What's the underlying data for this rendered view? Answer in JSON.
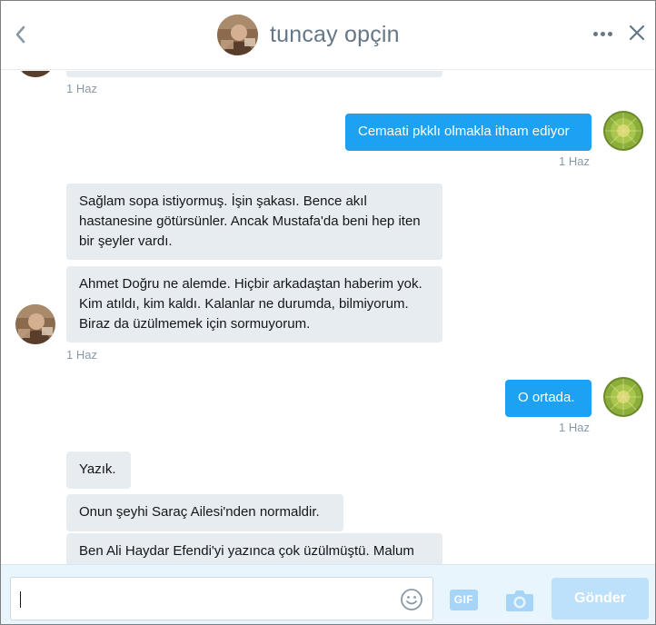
{
  "header": {
    "title": "tuncay opçin",
    "back_icon": "chevron-left-icon",
    "more_icon": "more-horizontal-icon",
    "close_icon": "close-icon"
  },
  "messages": [
    {
      "id": "m0",
      "direction": "in",
      "text": "",
      "timestamp": "1 Haz"
    },
    {
      "id": "m1",
      "direction": "out",
      "text": "Cemaati pkklı olmakla itham ediyor",
      "timestamp": "1 Haz"
    },
    {
      "id": "m2",
      "direction": "in",
      "text": "Sağlam sopa istiyormuş. İşin şakası. Bence akıl hastanesine götürsünler. Ancak Mustafa'da beni hep iten bir şeyler vardı."
    },
    {
      "id": "m3",
      "direction": "in",
      "text": "Ahmet Doğru ne alemde. Hiçbir arkadaştan haberim yok. Kim atıldı, kim kaldı. Kalanlar ne durumda, bilmiyorum. Biraz da üzülmemek için sormuyorum.",
      "timestamp": "1 Haz"
    },
    {
      "id": "m4",
      "direction": "out",
      "text": "O ortada.",
      "timestamp": "1 Haz"
    },
    {
      "id": "m5",
      "direction": "in",
      "text": "Yazık."
    },
    {
      "id": "m6",
      "direction": "in",
      "text": "Onun şeyhi Saraç Ailesi'nden normaldir."
    },
    {
      "id": "m7",
      "direction": "in",
      "text": "Ben Ali Haydar Efendi'yi yazınca çok üzülmüştü. Malum"
    }
  ],
  "composer": {
    "placeholder": "",
    "value": "",
    "gif_label": "GIF",
    "send_label": "Gönder",
    "emoji_icon": "emoji-icon",
    "camera_icon": "camera-icon"
  },
  "colors": {
    "accent": "#1da1f2",
    "incoming_bubble": "#e6ecf0",
    "send_disabled": "#bde1fa",
    "composer_bg": "#e8f5fd",
    "timestamp": "#8899a6"
  }
}
